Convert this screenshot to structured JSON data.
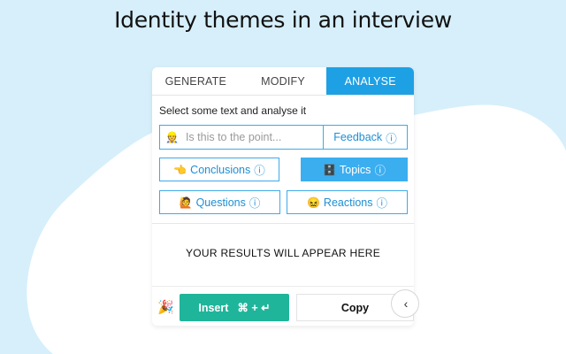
{
  "headline": "Identity themes in an interview",
  "tabs": [
    {
      "label": "GENERATE"
    },
    {
      "label": "MODIFY"
    },
    {
      "label": "ANALYSE"
    }
  ],
  "instruction": "Select some text and analyse it",
  "input": {
    "placeholder": "Is this to the point...",
    "emoji": "👷",
    "value": ""
  },
  "feedback": {
    "label": "Feedback",
    "info": "ⓘ"
  },
  "actions": {
    "conclusions": {
      "label": "Conclusions",
      "info": "ⓘ",
      "emoji": "👈"
    },
    "topics": {
      "label": "Topics",
      "info": "ⓘ",
      "emoji": "🗄️"
    },
    "questions": {
      "label": "Questions",
      "info": "ⓘ",
      "emoji": "🙋"
    },
    "reactions": {
      "label": "Reactions",
      "info": "ⓘ",
      "emoji": "😖"
    }
  },
  "results_text": "YOUR RESULTS WILL APPEAR HERE",
  "footer": {
    "party_emoji": "🎉",
    "insert_label": "Insert",
    "insert_shortcut": "⌘ + ↵",
    "copy_label": "Copy",
    "collapse_glyph": "‹"
  },
  "colors": {
    "background": "#d6effb",
    "accent": "#1ea0e4",
    "insert": "#1fb59a"
  }
}
